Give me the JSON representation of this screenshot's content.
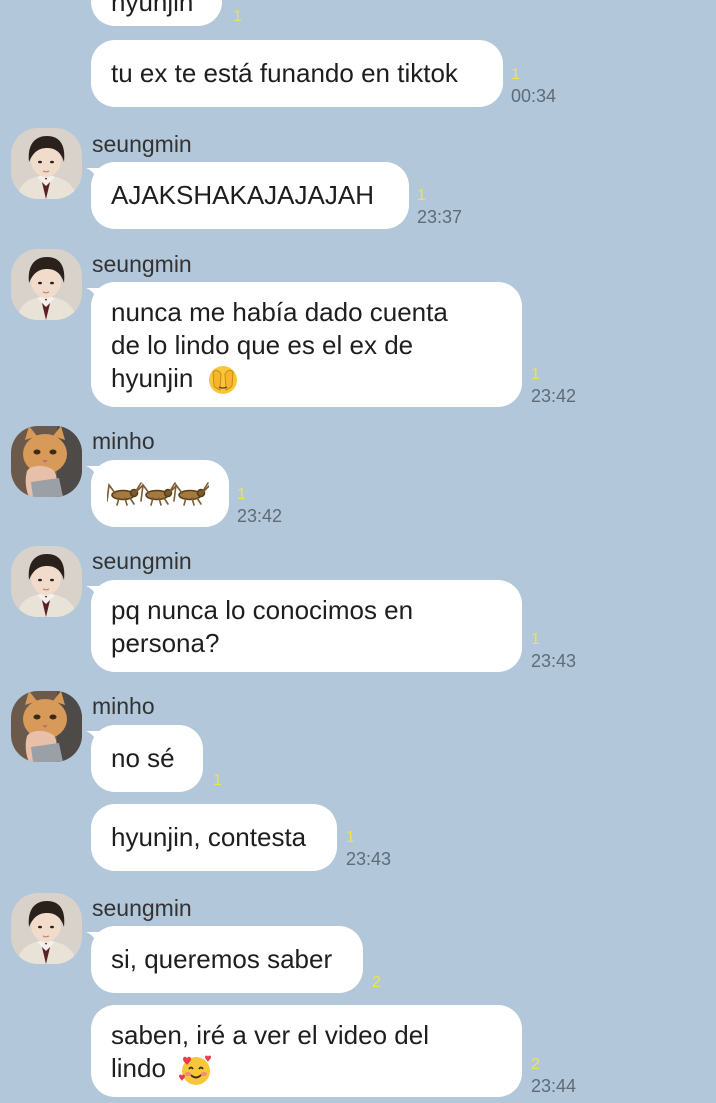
{
  "messages": [
    {
      "sender": "",
      "text": "hyunjin",
      "unread": "1",
      "time": ""
    },
    {
      "sender": "",
      "text": "tu ex te está funando en tiktok",
      "unread": "1",
      "time": "00:34"
    },
    {
      "sender": "seungmin",
      "text": "AJAKSHAKAJAJAJAH",
      "unread": "1",
      "time": "23:37"
    },
    {
      "sender": "seungmin",
      "lines": [
        "nunca me había dado cuenta",
        "de lo lindo que es el ex de",
        "hyunjin"
      ],
      "emoji": "face-with-peeking-eye",
      "unread": "1",
      "time": "23:42"
    },
    {
      "sender": "minho",
      "sticker": "three-crickets",
      "unread": "1",
      "time": "23:42"
    },
    {
      "sender": "seungmin",
      "lines": [
        "pq nunca lo conocimos en",
        "persona?"
      ],
      "unread": "1",
      "time": "23:43"
    },
    {
      "sender": "minho",
      "text": "no sé",
      "unread": "1",
      "time": ""
    },
    {
      "sender": "",
      "text": "hyunjin, contesta",
      "unread": "1",
      "time": "23:43"
    },
    {
      "sender": "seungmin",
      "text": "si, queremos saber",
      "unread": "2",
      "time": ""
    },
    {
      "sender": "",
      "lines": [
        "saben, iré a ver el video del",
        "lindo"
      ],
      "emoji": "smiling-face-with-hearts",
      "unread": "2",
      "time": "23:44"
    }
  ],
  "colors": {
    "background": "#b2c7d9",
    "bubble": "#ffffff",
    "unread": "#ece44a",
    "time": "#5e6b78"
  }
}
